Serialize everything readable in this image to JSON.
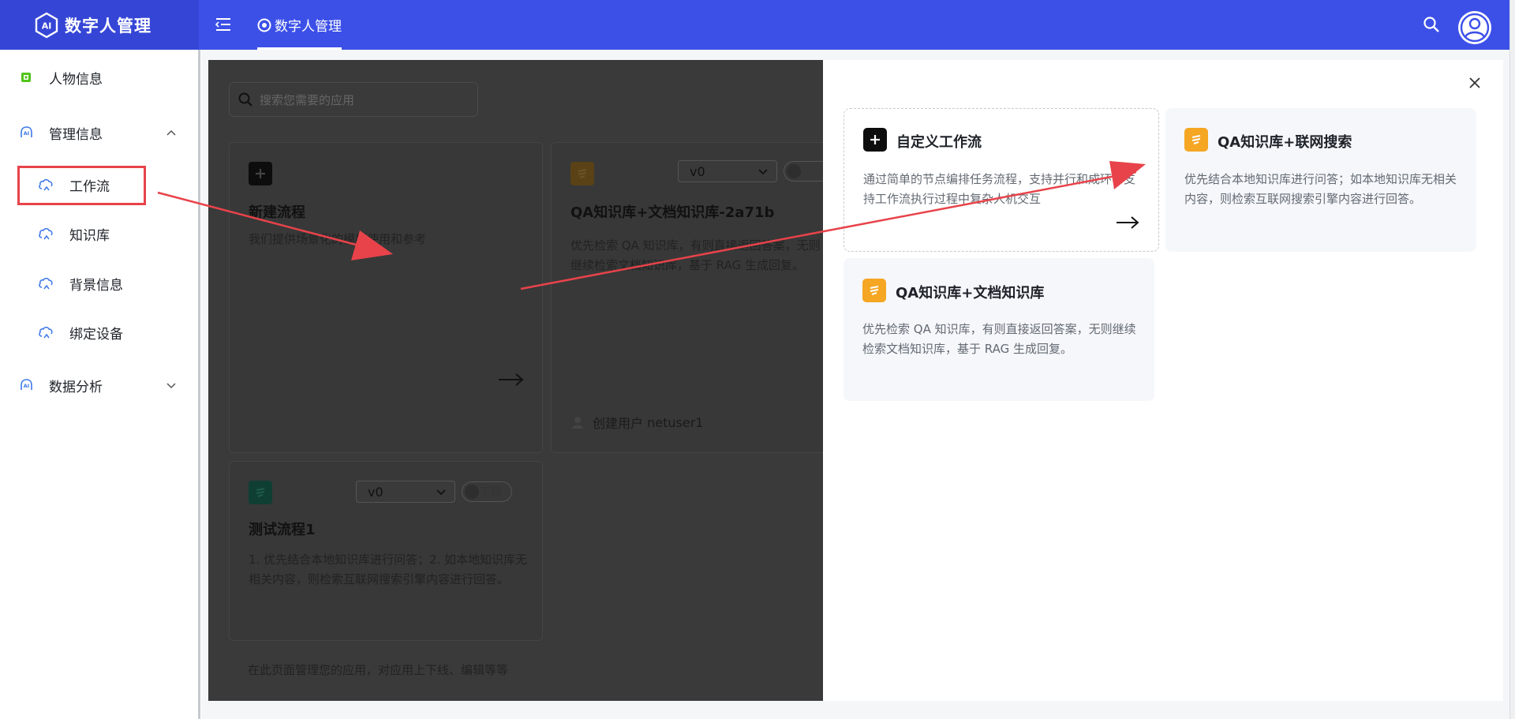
{
  "header": {
    "app_title": "数字人管理",
    "active_tab": "数字人管理"
  },
  "sidebar": {
    "items": [
      {
        "label": "人物信息"
      },
      {
        "label": "管理信息"
      },
      {
        "label": "数据分析"
      }
    ],
    "sub_items": [
      {
        "label": "工作流"
      },
      {
        "label": "知识库"
      },
      {
        "label": "背景信息"
      },
      {
        "label": "绑定设备"
      }
    ]
  },
  "background_page": {
    "search_placeholder": "搜索您需要的应用",
    "cards": [
      {
        "name": "新建流程",
        "desc": "我们提供场景化的模板使用和参考"
      },
      {
        "name": "QA知识库+文档知识库-2a71b",
        "desc": "优先检索 QA 知识库，有则直接返回答案，无则继续检索文档知识库，基于 RAG 生成回复。",
        "version": "v0",
        "creator_label": "创建用户",
        "creator": "netuser1"
      },
      {
        "name": "测试流程1",
        "desc": "1. 优先结合本地知识库进行问答；2. 如本地知识库无相关内容，则检索互联网搜索引擎内容进行回答。",
        "version": "v0",
        "status": "下线"
      }
    ],
    "footer": "在此页面管理您的应用，对应用上下线、编辑等等"
  },
  "drawer": {
    "templates": [
      {
        "name": "自定义工作流",
        "desc": "通过简单的节点编排任务流程，支持并行和成环，支持工作流执行过程中复杂人机交互"
      },
      {
        "name": "QA知识库+联网搜索",
        "desc": "优先结合本地知识库进行问答；如本地知识库无相关内容，则检索互联网搜索引擎内容进行回答。"
      },
      {
        "name": "QA知识库+文档知识库",
        "desc": "优先检索 QA 知识库，有则直接返回答案，无则继续检索文档知识库，基于 RAG 生成回复。"
      }
    ]
  },
  "colors": {
    "header": "#3c50e8",
    "accent_orange": "#f5a623",
    "annotation_red": "#e8434a"
  }
}
